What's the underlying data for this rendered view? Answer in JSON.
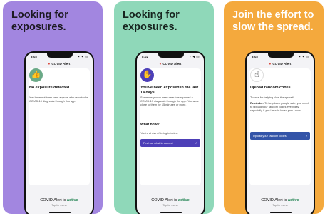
{
  "cards": [
    {
      "headline": "Looking for exposures.",
      "phone": {
        "time": "8:02",
        "app_title": "COVID Alert",
        "title": "No exposure detected",
        "body": "You have not been near anyone who reported a COVID-19 diagnosis through this app.",
        "footer_prefix": "COVID Alert is",
        "footer_status": "active",
        "footer_hint": "Tap for menu"
      }
    },
    {
      "headline": "Looking for exposures.",
      "phone": {
        "time": "8:02",
        "app_title": "COVID Alert",
        "title": "You've been exposed in the last 14 days",
        "body": "Someone you've been near has reported a COVID-19 diagnosis through the app. You were close to them for 15 minutes or more.",
        "subheading": "What now?",
        "risk": "You're at risk of being infected.",
        "button": "Find out what to do next",
        "footer_prefix": "COVID Alert is",
        "footer_status": "active",
        "footer_hint": "Tap for menu"
      }
    },
    {
      "headline": "Join the effort to slow the spread.",
      "phone": {
        "time": "8:02",
        "app_title": "COVID Alert",
        "title": "Upload random codes",
        "body_intro": "Thanks for helping slow the spread!",
        "body_label": "Reminder:",
        "body": "To help keep people safe, you need to upload your random codes every day, especially if you have to leave your home.",
        "button": "Upload your random codes",
        "footer_prefix": "COVID Alert is",
        "footer_status": "active",
        "footer_hint": "Tap for menu"
      }
    }
  ]
}
